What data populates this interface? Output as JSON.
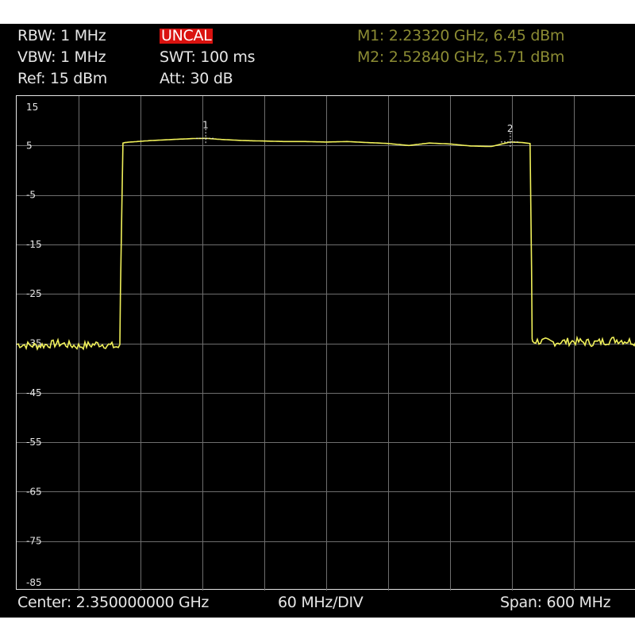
{
  "settings": {
    "rbw": "RBW: 1 MHz",
    "vbw": "VBW: 1 MHz",
    "ref": "Ref: 15 dBm",
    "uncal": "UNCAL",
    "swt": "SWT: 100 ms",
    "att": "Att: 30 dB"
  },
  "markers": {
    "m1": "M1: 2.23320 GHz, 6.45 dBm",
    "m2": "M2: 2.52840 GHz, 5.71 dBm"
  },
  "footer": {
    "center": "Center: 2.350000000 GHz",
    "div": "60 MHz/DIV",
    "span": "Span: 600 MHz"
  },
  "colors": {
    "background": "#000000",
    "trace": "#f0f05a",
    "grid": "#6e6e6e",
    "text": "#e6e6e6",
    "marker_readout": "#8b8b33",
    "uncal_badge": "#d9120f"
  },
  "chart_data": {
    "type": "line",
    "title": "",
    "xlabel": "",
    "ylabel": "",
    "xlim": [
      2.05,
      2.65
    ],
    "ylim": [
      -85,
      15
    ],
    "y_ticks": [
      15,
      5,
      -5,
      -15,
      -25,
      -35,
      -45,
      -55,
      -65,
      -75,
      -85
    ],
    "grid": true,
    "series": [
      {
        "x": [
          2.05,
          2.07,
          2.09,
          2.11,
          2.13,
          2.15,
          2.1505,
          2.153,
          2.155,
          2.16,
          2.18,
          2.2,
          2.22,
          2.2332,
          2.25,
          2.27,
          2.29,
          2.31,
          2.33,
          2.35,
          2.37,
          2.39,
          2.41,
          2.43,
          2.45,
          2.47,
          2.49,
          2.51,
          2.5284,
          2.54,
          2.5475,
          2.549,
          2.5495,
          2.55,
          2.57,
          2.59,
          2.61,
          2.63,
          2.65
        ],
        "y": [
          -35.2,
          -35.5,
          -35.0,
          -35.6,
          -35.1,
          -35.8,
          -25.0,
          5.5,
          5.6,
          5.7,
          6.0,
          6.2,
          6.4,
          6.45,
          6.2,
          6.0,
          5.9,
          5.8,
          5.8,
          5.7,
          5.8,
          5.6,
          5.4,
          5.0,
          5.5,
          5.3,
          4.9,
          4.8,
          5.71,
          5.6,
          5.4,
          -20.0,
          -34.0,
          -34.5,
          -34.8,
          -34.6,
          -34.9,
          -34.3,
          -34.7
        ]
      }
    ],
    "markers": [
      {
        "label": "1",
        "x": 2.2332,
        "y": 6.45
      },
      {
        "label": "2",
        "x": 2.5284,
        "y": 5.71
      }
    ]
  }
}
